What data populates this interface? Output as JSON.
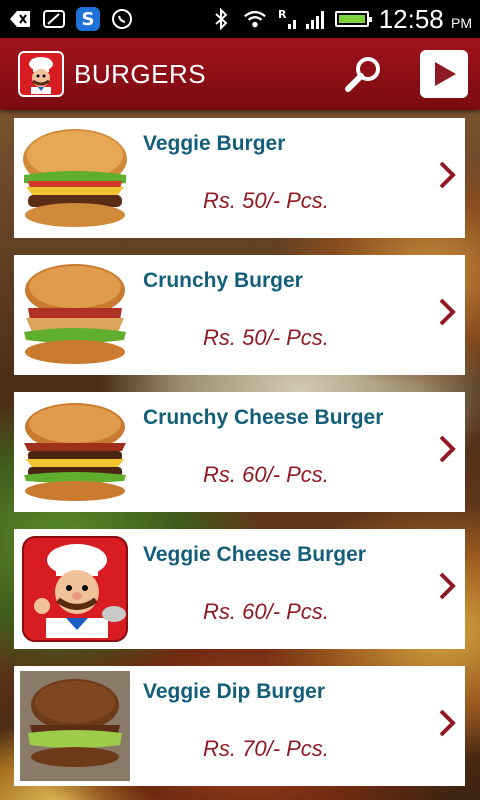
{
  "status_bar": {
    "time": "12:58",
    "ampm": "PM",
    "signal_label": "R"
  },
  "header": {
    "title": "BURGERS",
    "logo_icon": "chef-icon",
    "search_icon": "search-icon",
    "next_icon": "play-icon"
  },
  "items": [
    {
      "name": "Veggie Burger",
      "price": "Rs. 50/- Pcs.",
      "image": "burger-lettuce-cheese"
    },
    {
      "name": "Crunchy Burger",
      "price": "Rs. 50/- Pcs.",
      "image": "burger-crispy-patty"
    },
    {
      "name": "Crunchy Cheese Burger",
      "price": "Rs. 60/- Pcs.",
      "image": "burger-bacon-double"
    },
    {
      "name": "Veggie Cheese Burger",
      "price": "Rs. 60/- Pcs.",
      "image": "chef-placeholder"
    },
    {
      "name": "Veggie Dip Burger",
      "price": "Rs. 70/- Pcs.",
      "image": "burger-dip"
    }
  ],
  "colors": {
    "header": "#a1121b",
    "item_name": "#135f7a",
    "price": "#8f1a23",
    "chevron": "#8f1a23"
  }
}
